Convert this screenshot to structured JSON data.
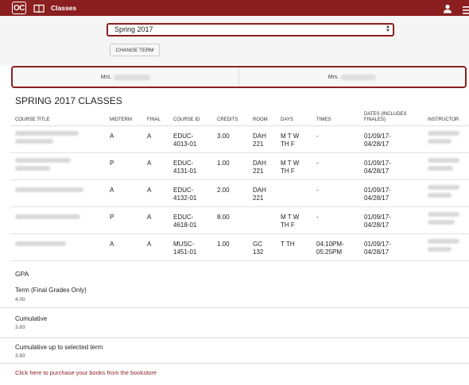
{
  "header": {
    "logo_text": "OC",
    "title": "Classes",
    "icons": [
      "book-icon",
      "user-icon",
      "menu-icon"
    ],
    "brand_color": "#8b1f1f"
  },
  "term": {
    "selected": "Spring 2017",
    "change_button": "CHANGE TERM"
  },
  "advisors": [
    {
      "prefix": "Mrs."
    },
    {
      "prefix": "Mrs."
    }
  ],
  "section_title": "SPRING 2017 CLASSES",
  "table": {
    "headers": {
      "course_title": "COURSE TITLE",
      "midterm": "MIDTERM",
      "final": "FINAL",
      "course_id": "COURSE ID",
      "credits": "CREDITS",
      "room": "ROOM",
      "days": "DAYS",
      "times": "TIMES",
      "dates_line1": "DATES (INCLUDES",
      "dates_line2": "FINALES)",
      "instructor": "INSTRUCTOR"
    },
    "rows": [
      {
        "midterm": "A",
        "final": "A",
        "id1": "EDUC-",
        "id2": "4013-01",
        "credits": "3.00",
        "room1": "DAH",
        "room2": "221",
        "days1": "M T W",
        "days2": "TH F",
        "times1": "-",
        "times2": "",
        "date1": "01/09/17-",
        "date2": "04/28/17"
      },
      {
        "midterm": "P",
        "final": "A",
        "id1": "EDUC-",
        "id2": "4131-01",
        "credits": "1.00",
        "room1": "DAH",
        "room2": "221",
        "days1": "M T W",
        "days2": "TH F",
        "times1": "-",
        "times2": "",
        "date1": "01/09/17-",
        "date2": "04/28/17"
      },
      {
        "midterm": "A",
        "final": "A",
        "id1": "EDUC-",
        "id2": "4132-01",
        "credits": "2.00",
        "room1": "DAH",
        "room2": "221",
        "days1": "",
        "days2": "",
        "times1": "-",
        "times2": "",
        "date1": "01/09/17-",
        "date2": "04/28/17"
      },
      {
        "midterm": "P",
        "final": "A",
        "id1": "EDUC-",
        "id2": "4618-01",
        "credits": "8.00",
        "room1": "",
        "room2": "",
        "days1": "M T W",
        "days2": "TH F",
        "times1": "-",
        "times2": "",
        "date1": "01/09/17-",
        "date2": "04/28/17"
      },
      {
        "midterm": "A",
        "final": "A",
        "id1": "MUSC-",
        "id2": "1451-01",
        "credits": "1.00",
        "room1": "GC",
        "room2": "132",
        "days1": "T TH",
        "days2": "",
        "times1": "04:10PM-",
        "times2": "05:25PM",
        "date1": "01/09/17-",
        "date2": "04/28/17"
      }
    ]
  },
  "gpa": {
    "title": "GPA",
    "items": [
      {
        "label": "Term (Final Grades Only)",
        "value": "4.00"
      },
      {
        "label": "Cumulative",
        "value": "3.83"
      },
      {
        "label": "Cumulative up to selected term",
        "value": "3.83"
      }
    ]
  },
  "bookstore_link": "Click here to purchase your books from the bookstore"
}
